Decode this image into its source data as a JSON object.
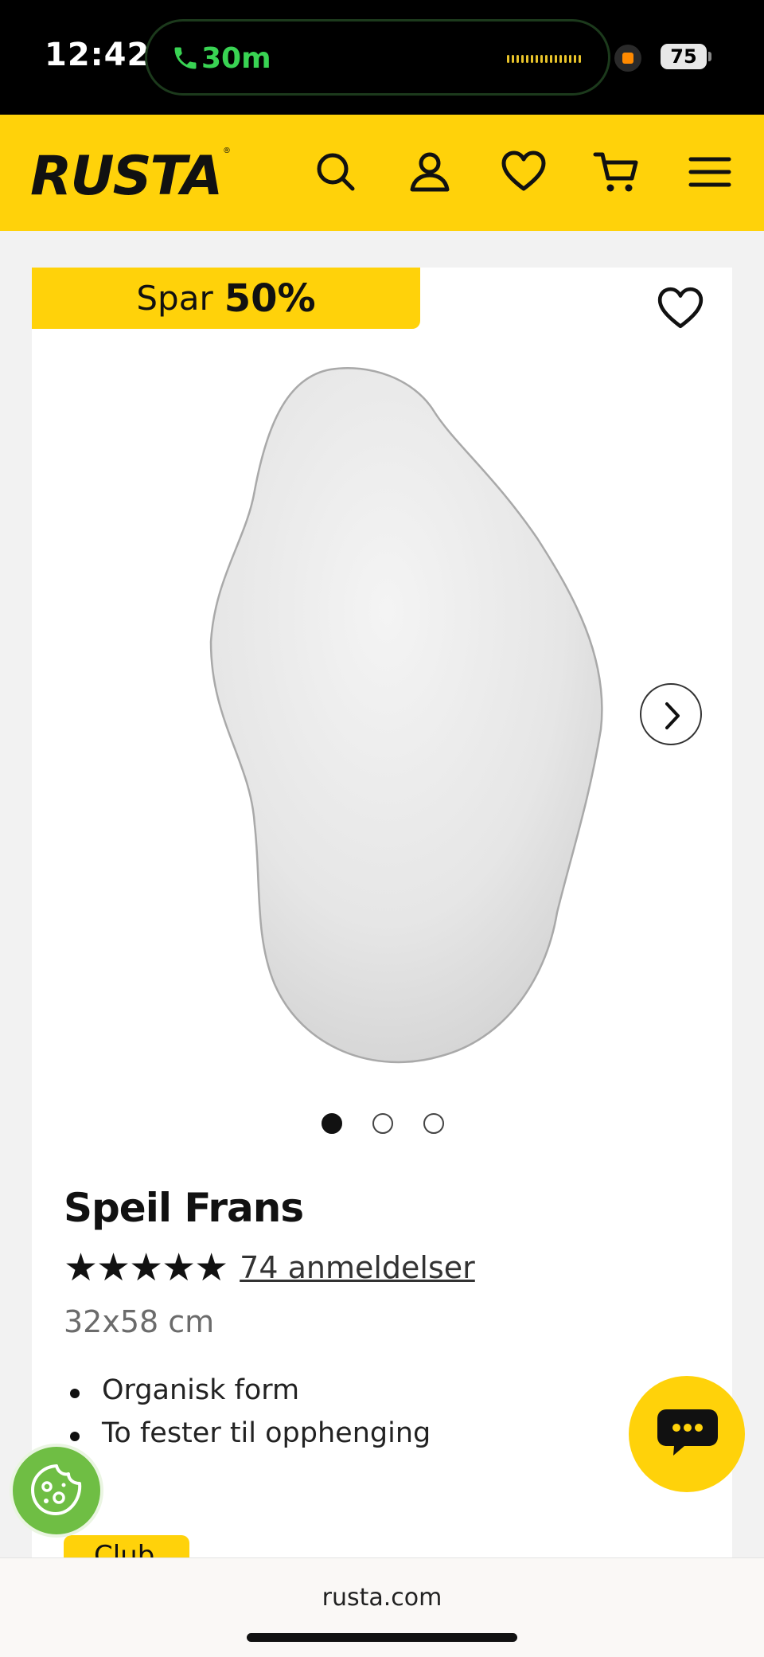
{
  "status_bar": {
    "time": "12:42",
    "call_duration": "30m",
    "battery": "75"
  },
  "header": {
    "logo": "RUSTA",
    "logo_mark": "®",
    "icons": [
      "search-icon",
      "account-icon",
      "wishlist-icon",
      "cart-icon",
      "menu-icon"
    ]
  },
  "product": {
    "save_label": "Spar",
    "save_value": "50%",
    "name": "Speil Frans",
    "stars": "★★★★★",
    "rating": 5,
    "reviews": "74 anmeldelser",
    "size": "32x58 cm",
    "features": [
      "Organisk form",
      "To fester til opphenging"
    ],
    "badge": "Club",
    "image_count": 3,
    "active_image": 1
  },
  "browser": {
    "url": "rusta.com"
  },
  "colors": {
    "brand_yellow": "#ffd20a",
    "cookie_green": "#6fbe44",
    "call_green": "#39d353"
  }
}
